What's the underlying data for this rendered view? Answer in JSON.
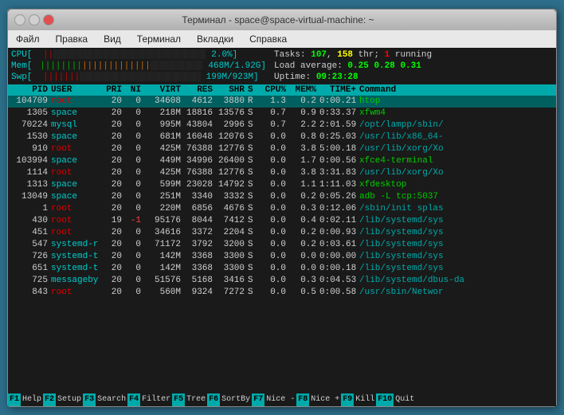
{
  "window": {
    "title": "Терминал - space@space-virtual-machine: ~",
    "buttons": {
      "close": "×",
      "minimize": "−",
      "maximize": "□"
    }
  },
  "menubar": {
    "items": [
      "Файл",
      "Правка",
      "Вид",
      "Терминал",
      "Вкладки",
      "Справка"
    ]
  },
  "htop": {
    "cpu_label": "CPU[",
    "cpu_bar": "||",
    "cpu_pct": "2.0%]",
    "mem_label": "Mem[",
    "mem_bar": "||||||||||||||||||||",
    "mem_value": "468M/1.92G]",
    "swp_label": "Swp[",
    "swp_bar": "|||||||",
    "swp_value": "199M/923M]",
    "tasks_label": "Tasks:",
    "tasks_count": "107",
    "thr_count": "158",
    "thr_label": "thr;",
    "running": "1",
    "running_label": "running",
    "load_label": "Load average:",
    "load1": "0.25",
    "load5": "0.28",
    "load15": "0.31",
    "uptime_label": "Uptime:",
    "uptime": "09:23:28"
  },
  "table": {
    "headers": [
      "PID",
      "USER",
      "PRI",
      "NI",
      "VIRT",
      "RES",
      "SHR",
      "S",
      "CPU%",
      "MEM%",
      "TIME+",
      "Command"
    ],
    "rows": [
      {
        "pid": "104709",
        "user": "root",
        "pri": "20",
        "ni": "0",
        "virt": "34608",
        "res": "4612",
        "shr": "3880",
        "s": "R",
        "cpu": "1.3",
        "mem": "0.2",
        "time": "0:00.21",
        "cmd": "htop",
        "cmd_color": "green",
        "highlight": true
      },
      {
        "pid": "1305",
        "user": "space",
        "pri": "20",
        "ni": "0",
        "virt": "218M",
        "res": "18816",
        "shr": "13576",
        "s": "S",
        "cpu": "0.7",
        "mem": "0.9",
        "time": "0:33.37",
        "cmd": "xfwm4",
        "cmd_color": "green"
      },
      {
        "pid": "70224",
        "user": "mysql",
        "pri": "20",
        "ni": "0",
        "virt": "995M",
        "res": "43804",
        "shr": "2996",
        "s": "S",
        "cpu": "0.7",
        "mem": "2.2",
        "time": "2:01.59",
        "cmd": "/opt/lampp/sbin/",
        "cmd_color": "cyan"
      },
      {
        "pid": "1530",
        "user": "space",
        "pri": "20",
        "ni": "0",
        "virt": "681M",
        "res": "16048",
        "shr": "12076",
        "s": "S",
        "cpu": "0.0",
        "mem": "0.8",
        "time": "0:25.03",
        "cmd": "/usr/lib/x86_64-",
        "cmd_color": "cyan"
      },
      {
        "pid": "910",
        "user": "root",
        "pri": "20",
        "ni": "0",
        "virt": "425M",
        "res": "76388",
        "shr": "12776",
        "s": "S",
        "cpu": "0.0",
        "mem": "3.8",
        "time": "5:00.18",
        "cmd": "/usr/lib/xorg/Xo",
        "cmd_color": "cyan"
      },
      {
        "pid": "103994",
        "user": "space",
        "pri": "20",
        "ni": "0",
        "virt": "449M",
        "res": "34996",
        "shr": "26400",
        "s": "S",
        "cpu": "0.0",
        "mem": "1.7",
        "time": "0:00.56",
        "cmd": "xfce4-terminal",
        "cmd_color": "green"
      },
      {
        "pid": "1114",
        "user": "root",
        "pri": "20",
        "ni": "0",
        "virt": "425M",
        "res": "76388",
        "shr": "12776",
        "s": "S",
        "cpu": "0.0",
        "mem": "3.8",
        "time": "3:31.83",
        "cmd": "/usr/lib/xorg/Xo",
        "cmd_color": "cyan"
      },
      {
        "pid": "1313",
        "user": "space",
        "pri": "20",
        "ni": "0",
        "virt": "599M",
        "res": "23028",
        "shr": "14792",
        "s": "S",
        "cpu": "0.0",
        "mem": "1.1",
        "time": "1:11.03",
        "cmd": "xfdesktop",
        "cmd_color": "green"
      },
      {
        "pid": "13049",
        "user": "space",
        "pri": "20",
        "ni": "0",
        "virt": "251M",
        "res": "3340",
        "shr": "3332",
        "s": "S",
        "cpu": "0.0",
        "mem": "0.2",
        "time": "0:05.26",
        "cmd": "adb -L tcp:5037",
        "cmd_color": "green"
      },
      {
        "pid": "1",
        "user": "root",
        "pri": "20",
        "ni": "0",
        "virt": "220M",
        "res": "6856",
        "shr": "4676",
        "s": "S",
        "cpu": "0.0",
        "mem": "0.3",
        "time": "0:12.06",
        "cmd": "/sbin/init splas",
        "cmd_color": "cyan"
      },
      {
        "pid": "430",
        "user": "root",
        "pri": "19",
        "ni": "-1",
        "virt": "95176",
        "res": "8044",
        "shr": "7412",
        "s": "S",
        "cpu": "0.0",
        "mem": "0.4",
        "time": "0:02.11",
        "cmd": "/lib/systemd/sys",
        "cmd_color": "cyan"
      },
      {
        "pid": "451",
        "user": "root",
        "pri": "20",
        "ni": "0",
        "virt": "34616",
        "res": "3372",
        "shr": "2204",
        "s": "S",
        "cpu": "0.0",
        "mem": "0.2",
        "time": "0:00.93",
        "cmd": "/lib/systemd/sys",
        "cmd_color": "cyan"
      },
      {
        "pid": "547",
        "user": "systemd-r",
        "pri": "20",
        "ni": "0",
        "virt": "71172",
        "res": "3792",
        "shr": "3200",
        "s": "S",
        "cpu": "0.0",
        "mem": "0.2",
        "time": "0:03.61",
        "cmd": "/lib/systemd/sys",
        "cmd_color": "cyan"
      },
      {
        "pid": "726",
        "user": "systemd-t",
        "pri": "20",
        "ni": "0",
        "virt": "142M",
        "res": "3368",
        "shr": "3300",
        "s": "S",
        "cpu": "0.0",
        "mem": "0.0",
        "time": "0:00.00",
        "cmd": "/lib/systemd/sys",
        "cmd_color": "cyan"
      },
      {
        "pid": "651",
        "user": "systemd-t",
        "pri": "20",
        "ni": "0",
        "virt": "142M",
        "res": "3368",
        "shr": "3300",
        "s": "S",
        "cpu": "0.0",
        "mem": "0.0",
        "time": "0:00.18",
        "cmd": "/lib/systemd/sys",
        "cmd_color": "cyan"
      },
      {
        "pid": "725",
        "user": "messagebу",
        "pri": "20",
        "ni": "0",
        "virt": "51576",
        "res": "5168",
        "shr": "3416",
        "s": "S",
        "cpu": "0.0",
        "mem": "0.3",
        "time": "0:04.53",
        "cmd": "/lib/systemd/dbus-da",
        "cmd_color": "cyan"
      },
      {
        "pid": "843",
        "user": "root",
        "pri": "20",
        "ni": "0",
        "virt": "560M",
        "res": "9324",
        "shr": "7272",
        "s": "S",
        "cpu": "0.0",
        "mem": "0.5",
        "time": "0:00.58",
        "cmd": "/usr/sbin/Networ",
        "cmd_color": "cyan"
      }
    ]
  },
  "footer": {
    "items": [
      {
        "key": "F1",
        "label": "Help"
      },
      {
        "key": "F2",
        "label": "Setup"
      },
      {
        "key": "F3",
        "label": "Search"
      },
      {
        "key": "F4",
        "label": "Filter"
      },
      {
        "key": "F5",
        "label": "Tree"
      },
      {
        "key": "F6",
        "label": "SortBy"
      },
      {
        "key": "F7",
        "label": "Nice -"
      },
      {
        "key": "F8",
        "label": "Nice +"
      },
      {
        "key": "F9",
        "label": "Kill"
      },
      {
        "key": "F10",
        "label": "Quit"
      }
    ]
  }
}
